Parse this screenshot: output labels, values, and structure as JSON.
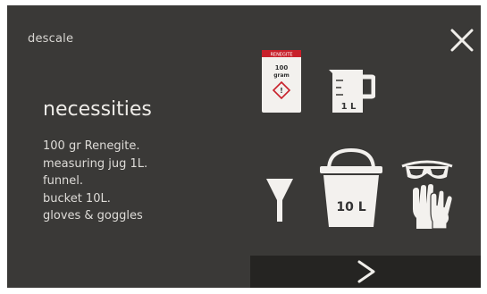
{
  "screen": {
    "title": "descale",
    "heading": "necessities",
    "items": [
      "100 gr Renegite.",
      "measuring jug 1L.",
      "funnel.",
      "bucket 10L.",
      "gloves & goggles"
    ]
  },
  "icons": {
    "package": {
      "name": "renegite-package-icon",
      "brand": "RENEGITE",
      "amount": "100\ngram"
    },
    "jug": {
      "name": "measuring-jug-icon",
      "label": "1 L"
    },
    "funnel": {
      "name": "funnel-icon"
    },
    "bucket": {
      "name": "bucket-icon",
      "label": "10 L"
    },
    "goggles": {
      "name": "goggles-icon"
    },
    "gloves": {
      "name": "gloves-icon"
    }
  },
  "controls": {
    "close": "close-icon",
    "next": "chevron-right-icon"
  },
  "colors": {
    "background": "#3a3937",
    "next_bar": "#252422",
    "text": "#dedcd8",
    "icon": "#f3f1ee",
    "brand_red": "#c8202a"
  }
}
